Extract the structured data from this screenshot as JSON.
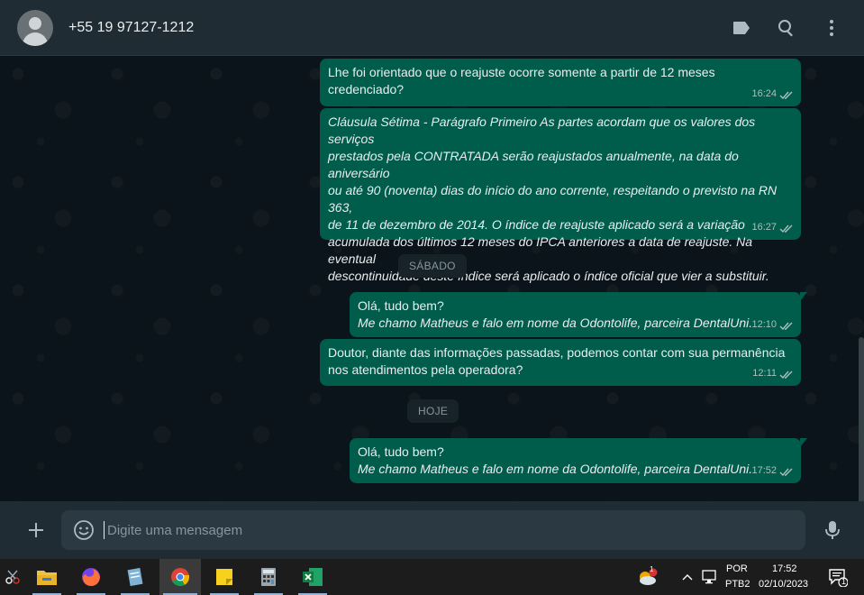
{
  "header": {
    "contact_name": "+55 19 97127-1212",
    "icons": [
      "label-icon",
      "search-icon",
      "menu-icon"
    ]
  },
  "messages": [
    {
      "text": "Lhe foi orientado que o reajuste ocorre somente a partir de 12 meses\ncredenciado?",
      "time": "16:24",
      "italic": false
    },
    {
      "text": "Cláusula Sétima - Parágrafo Primeiro  As partes acordam que os valores dos serviços\nprestados pela CONTRATADA serão reajustados anualmente, na data do aniversário\nou até 90 (noventa) dias do início do ano corrente, respeitando o previsto na RN 363,\nde 11 de dezembro de 2014. O índice de reajuste aplicado será a variação\nacumulada dos últimos 12 meses do IPCA anteriores a data de reajuste. Na eventual\ndescontinuidade deste índice será aplicado o índice oficial que vier a substituir.",
      "time": "16:27",
      "italic": true
    },
    {
      "text_line1": "Olá, tudo bem?",
      "text_line2": "Me chamo Matheus e falo em nome da Odontolife, parceira DentalUni.",
      "time": "12:10"
    },
    {
      "text": "Doutor, diante das informações passadas, podemos contar com sua permanência\nnos atendimentos pela operadora?",
      "time": "12:11",
      "italic": false
    },
    {
      "text_line1": "Olá, tudo bem?",
      "text_line2": "Me chamo Matheus e falo em nome da Odontolife, parceira DentalUni.",
      "time": "17:52"
    }
  ],
  "day_separators": {
    "saturday": "SÁBADO",
    "today": "HOJE"
  },
  "compose": {
    "placeholder": "Digite uma mensagem"
  },
  "taskbar": {
    "apps": [
      "snipping-tool-icon",
      "file-explorer-icon",
      "firefox-icon",
      "notepad-icon",
      "chrome-icon",
      "sticky-notes-icon",
      "calculator-icon",
      "excel-icon"
    ],
    "language": "POR",
    "keyboard": "PTB2",
    "time": "17:52",
    "date": "02/10/2023",
    "notification_count": "1",
    "weather_badge": "1"
  },
  "colors": {
    "outgoing_bubble": "#005c4b",
    "chat_background": "#0b141a",
    "header_background": "#202c33"
  }
}
